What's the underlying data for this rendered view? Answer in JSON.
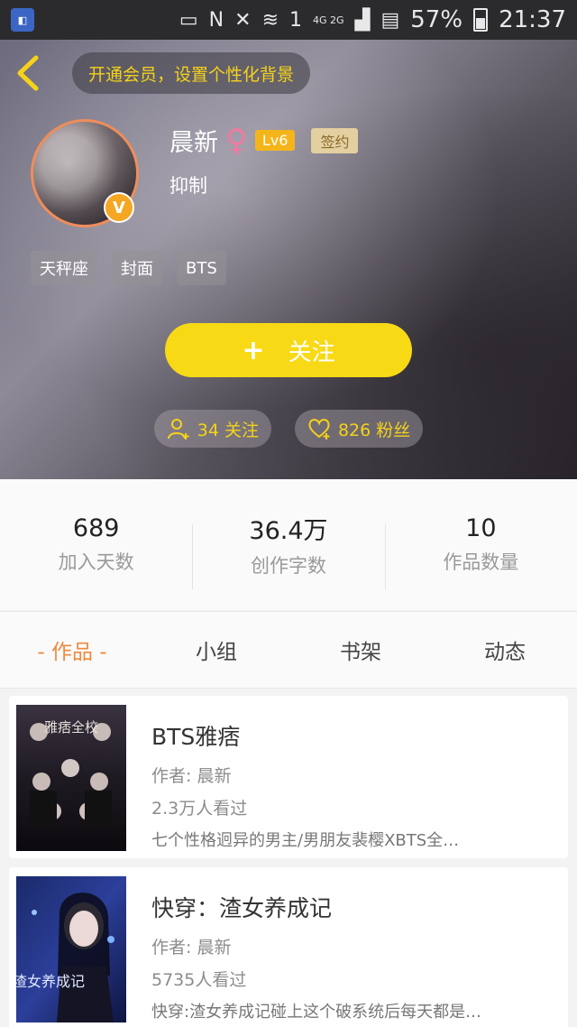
{
  "statusbar": {
    "battery": "57%",
    "time": "21:37",
    "network": "4G 2G",
    "sim": "1",
    "carrier_n": "N"
  },
  "header": {
    "vip_prompt": "开通会员，设置个性化背景",
    "username": "晨新",
    "gender_symbol": "♀",
    "level": "Lv6",
    "sign_badge": "签约",
    "signature": "抑制",
    "v_badge": "V",
    "tags": [
      "天秤座",
      "封面",
      "BTS"
    ],
    "follow_label": "关注",
    "follow_plus": "+",
    "following_count": "34 关注",
    "fans_count": "826 粉丝",
    "accent_color": "#f7d916"
  },
  "stats": [
    {
      "value": "689",
      "label": "加入天数"
    },
    {
      "value": "36.4万",
      "label": "创作字数"
    },
    {
      "value": "10",
      "label": "作品数量"
    }
  ],
  "tabs": [
    {
      "label": "- 作品 -",
      "active": true
    },
    {
      "label": "小组",
      "active": false
    },
    {
      "label": "书架",
      "active": false
    },
    {
      "label": "动态",
      "active": false
    }
  ],
  "books": [
    {
      "title": "BTS雅痞",
      "author": "作者: 晨新",
      "views": "2.3万人看过",
      "desc": "七个性格迥异的男主/男朋友裴樱XBTS全…",
      "cover_text": "雅痞全校"
    },
    {
      "title": "快穿：渣女养成记",
      "author": "作者: 晨新",
      "views": "5735人看过",
      "desc": "快穿:渣女养成记碰上这个破系统后每天都是…",
      "cover_text": "渣女养成记"
    }
  ]
}
